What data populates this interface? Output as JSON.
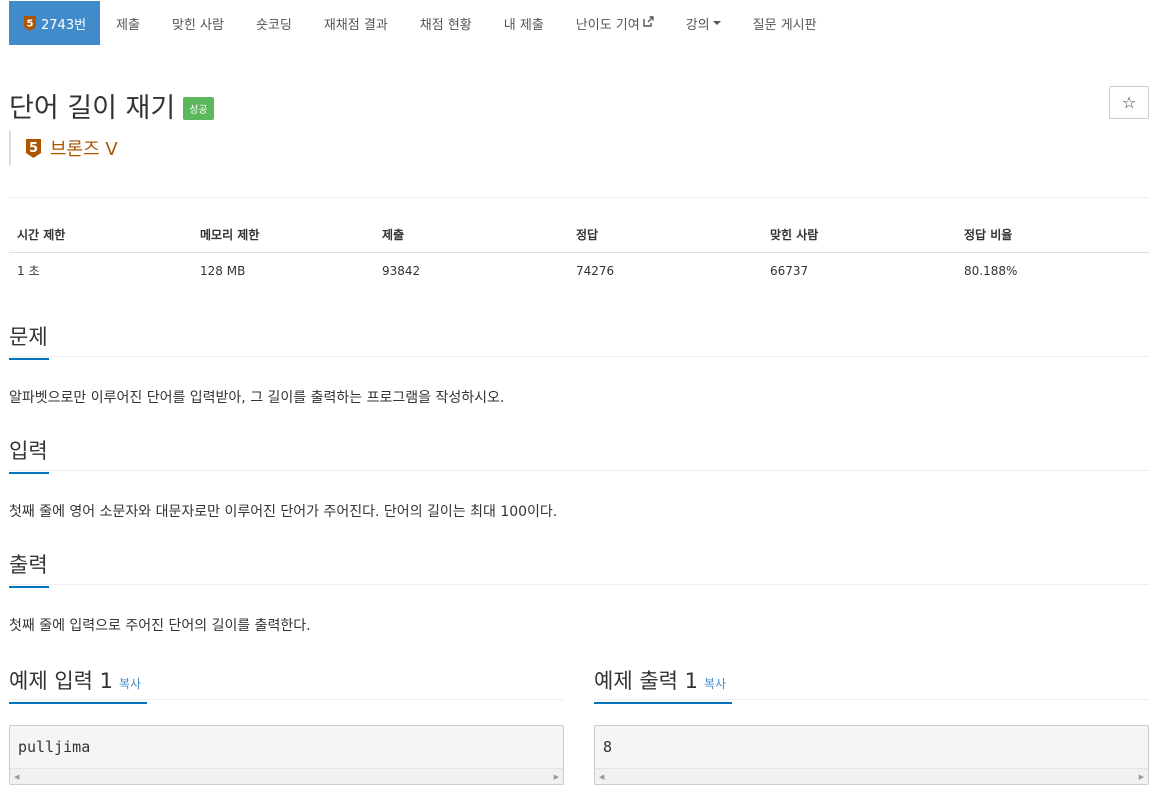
{
  "nav": {
    "problem_tier_digit": "5",
    "problem_number": "2743번",
    "items": [
      "제출",
      "맞힌 사람",
      "숏코딩",
      "재채점 결과",
      "채점 현황",
      "내 제출",
      "난이도 기여",
      "강의"
    ]
  },
  "title": "단어 길이 재기",
  "status_badge": "성공",
  "star_icon": "☆",
  "tier": {
    "digit": "5",
    "label": "브론즈 V",
    "color": "#ad5600"
  },
  "stats": {
    "headers": [
      "시간 제한",
      "메모리 제한",
      "제출",
      "정답",
      "맞힌 사람",
      "정답 비율"
    ],
    "values": [
      "1 초",
      "128 MB",
      "93842",
      "74276",
      "66737",
      "80.188%"
    ]
  },
  "sections": {
    "problem": {
      "title": "문제",
      "text": "알파벳으로만 이루어진 단어를 입력받아, 그 길이를 출력하는 프로그램을 작성하시오."
    },
    "input": {
      "title": "입력",
      "text": "첫째 줄에 영어 소문자와 대문자로만 이루어진 단어가 주어진다. 단어의 길이는 최대 100이다."
    },
    "output": {
      "title": "출력",
      "text": "첫째 줄에 입력으로 주어진 단어의 길이를 출력한다."
    }
  },
  "samples": {
    "input": {
      "title": "예제 입력 1",
      "copy": "복사",
      "code": "pulljima"
    },
    "output": {
      "title": "예제 출력 1",
      "copy": "복사",
      "code": "8"
    }
  },
  "colors": {
    "accent": "#428bca",
    "success": "#5cb85c",
    "underline": "#0076c0"
  }
}
